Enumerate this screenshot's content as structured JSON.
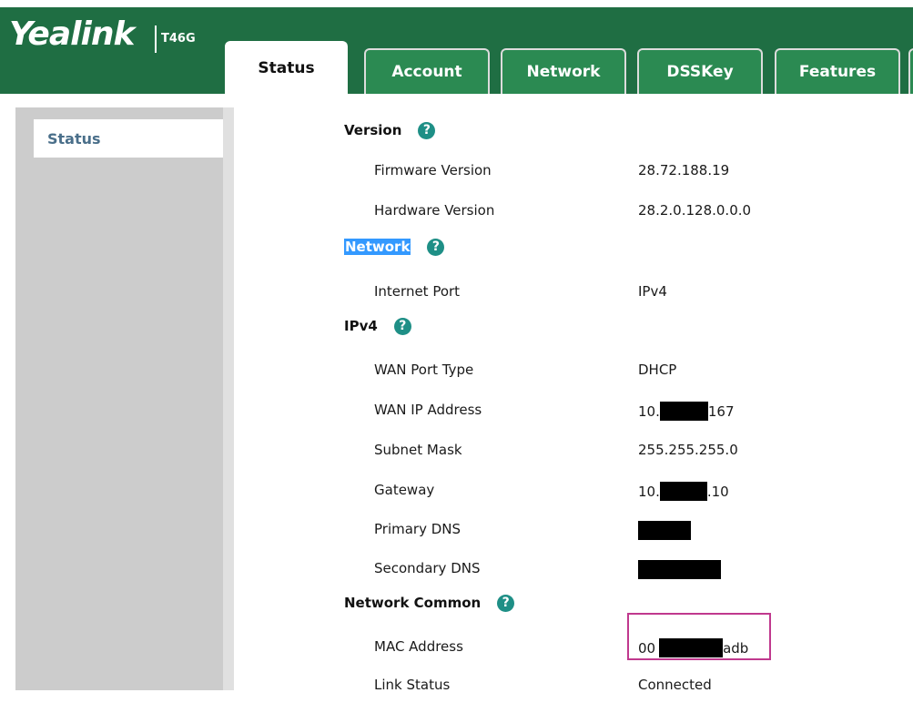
{
  "header": {
    "brand": "Yealink",
    "model": "T46G",
    "tabs": [
      {
        "label": "Status",
        "active": true
      },
      {
        "label": "Account",
        "active": false
      },
      {
        "label": "Network",
        "active": false
      },
      {
        "label": "DSSKey",
        "active": false
      },
      {
        "label": "Features",
        "active": false
      }
    ]
  },
  "sidebar": {
    "items": [
      {
        "label": "Status"
      }
    ]
  },
  "sections": {
    "version": {
      "title": "Version",
      "firmware_label": "Firmware Version",
      "firmware_value": "28.72.188.19",
      "hardware_label": "Hardware Version",
      "hardware_value": "28.2.0.128.0.0.0"
    },
    "network": {
      "title": "Network",
      "internet_port_label": "Internet Port",
      "internet_port_value": "IPv4"
    },
    "ipv4": {
      "title": "IPv4",
      "wan_port_type_label": "WAN Port Type",
      "wan_port_type_value": "DHCP",
      "wan_ip_label": "WAN IP Address",
      "wan_ip_prefix": "10.",
      "wan_ip_suffix": "167",
      "subnet_label": "Subnet Mask",
      "subnet_value": "255.255.255.0",
      "gateway_label": "Gateway",
      "gateway_prefix": "10.",
      "gateway_suffix": ".10",
      "primary_dns_label": "Primary DNS",
      "secondary_dns_label": "Secondary DNS"
    },
    "network_common": {
      "title": "Network Common",
      "mac_label": "MAC Address",
      "mac_prefix": "00",
      "mac_suffix": "adb",
      "link_status_label": "Link Status",
      "link_status_value": "Connected"
    }
  },
  "icons": {
    "help": "question-mark-circle-icon",
    "help_glyph": "?"
  },
  "colors": {
    "header_green": "#1f6e43",
    "tab_green": "#2b8a52",
    "help_teal": "#1e8f86",
    "highlight_blue": "#3399ff",
    "annotation_magenta": "#c0398e",
    "sidebar_gray": "#cccccc"
  }
}
